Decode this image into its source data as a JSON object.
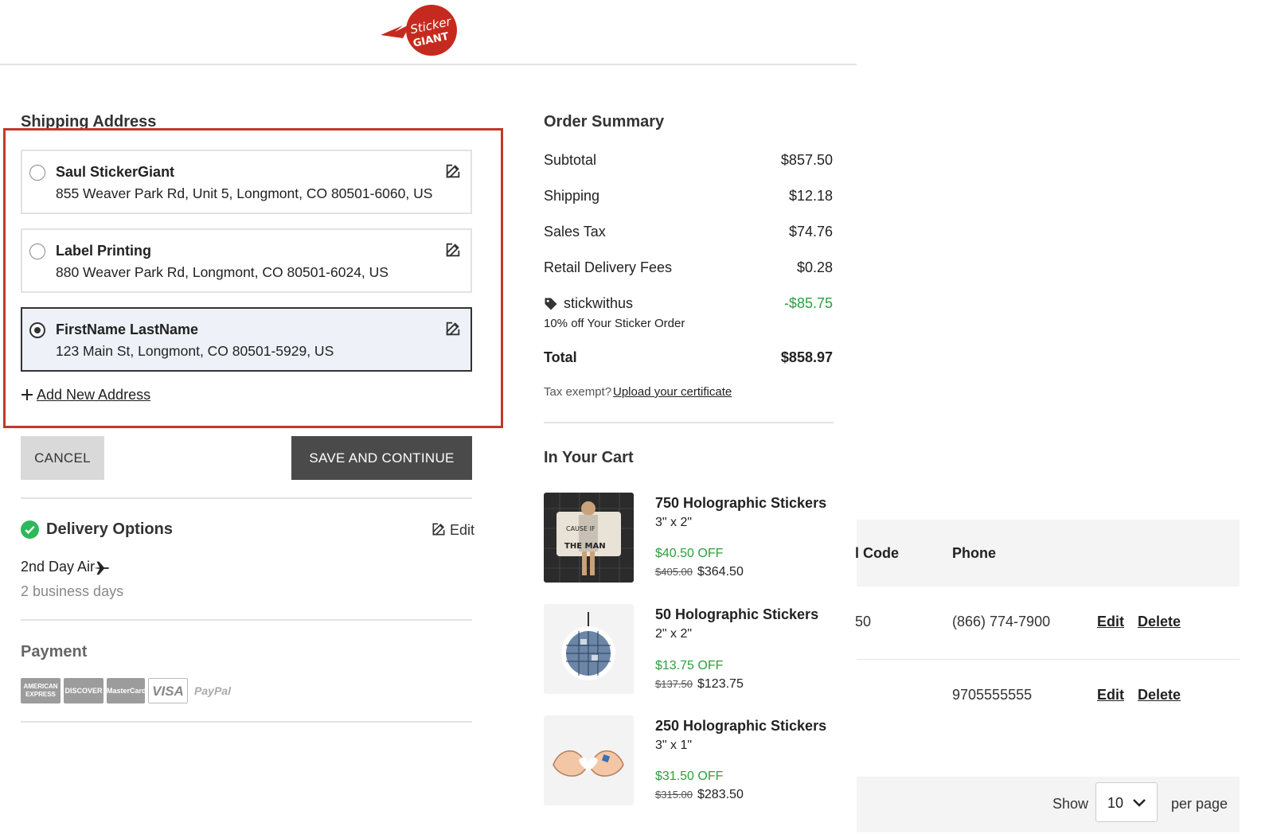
{
  "header": {
    "logo_text_top": "Sticker",
    "logo_text_bottom": "GIANT",
    "brand_color": "#c62a1e"
  },
  "shipping": {
    "title": "Shipping Address",
    "addresses": [
      {
        "name": "Saul StickerGiant",
        "line": "855 Weaver Park Rd, Unit 5, Longmont, CO 80501-6060, US",
        "selected": false
      },
      {
        "name": "Label Printing",
        "line": "880 Weaver Park Rd, Longmont, CO 80501-6024, US",
        "selected": false
      },
      {
        "name": "FirstName LastName",
        "line": "123 Main St, Longmont, CO 80501-5929, US",
        "selected": true
      }
    ],
    "add_new_label": "Add New Address",
    "cancel_label": "CANCEL",
    "save_label": "SAVE AND CONTINUE",
    "highlight_color": "#c0392b"
  },
  "delivery": {
    "title": "Delivery Options",
    "edit_label": "Edit",
    "method": "2nd Day Air",
    "time": "2 business days",
    "status_color": "#2eb85c"
  },
  "payment": {
    "title": "Payment",
    "cards": [
      "AMERICAN EXPRESS",
      "DISCOVER",
      "MasterCard",
      "VISA",
      "PayPal"
    ]
  },
  "summary": {
    "title": "Order Summary",
    "subtotal_label": "Subtotal",
    "subtotal_value": "$857.50",
    "shipping_label": "Shipping",
    "shipping_value": "$12.18",
    "tax_label": "Sales Tax",
    "tax_value": "$74.76",
    "fees_label": "Retail Delivery Fees",
    "fees_value": "$0.28",
    "promo_code": "stickwithus",
    "promo_value": "-$85.75",
    "promo_desc": "10% off Your Sticker Order",
    "total_label": "Total",
    "total_value": "$858.97",
    "tax_exempt_label": "Tax exempt?",
    "tax_exempt_link": "Upload your certificate",
    "discount_color": "#2e9e3e"
  },
  "cart": {
    "title": "In Your Cart",
    "items": [
      {
        "name": "750 Holographic Stickers",
        "size": "3\" x 2\"",
        "off": "$40.50 OFF",
        "orig": "$405.00",
        "price": "$364.50",
        "sticker_text": "CAUSE IF I WAS THEN I'D BE THE MAN"
      },
      {
        "name": "50 Holographic Stickers",
        "size": "2\" x 2\"",
        "off": "$13.75 OFF",
        "orig": "$137.50",
        "price": "$123.75"
      },
      {
        "name": "250 Holographic Stickers",
        "size": "3\" x 1\"",
        "off": "$31.50 OFF",
        "orig": "$315.00",
        "price": "$283.50"
      }
    ]
  },
  "background_table": {
    "col_code": "l Code",
    "col_phone": "Phone",
    "rows": [
      {
        "code": "50",
        "phone": "(866) 774-7900",
        "edit": "Edit",
        "delete": "Delete"
      },
      {
        "code": "",
        "phone": "9705555555",
        "edit": "Edit",
        "delete": "Delete"
      }
    ],
    "show_label": "Show",
    "per_page_value": "10",
    "per_page_label": "per page"
  }
}
